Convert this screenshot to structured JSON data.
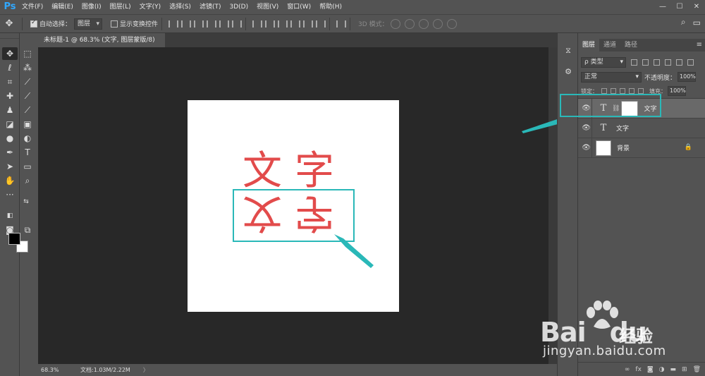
{
  "app": {
    "logo": "Ps"
  },
  "menu": [
    "文件(F)",
    "编辑(E)",
    "图像(I)",
    "图层(L)",
    "文字(Y)",
    "选择(S)",
    "滤镜(T)",
    "3D(D)",
    "视图(V)",
    "窗口(W)",
    "帮助(H)"
  ],
  "window_controls": {
    "minimize": "—",
    "maximize": "☐",
    "close": "✕"
  },
  "options": {
    "auto_select_label": "自动选择：",
    "auto_select_value": "图层",
    "show_transform_label": "显示变换控件",
    "mode_3d_label": "3D 模式："
  },
  "document": {
    "tab_title": "未标题-1 @ 68.3% (文字, 图层蒙版/8) *",
    "close": "×",
    "glyph_top_left": "文",
    "glyph_top_right": "字",
    "glyph_bottom_left": "文",
    "glyph_bottom_right": "字"
  },
  "status": {
    "zoom": "68.3%",
    "doc_info": "文档:1.03M/2.22M",
    "arrow": "〉"
  },
  "layers_panel": {
    "tabs": [
      "图层",
      "通道",
      "路径"
    ],
    "menu_icon": "≡",
    "filter_kind": "ρ 类型",
    "blend_mode": "正常",
    "opacity_label": "不透明度：",
    "opacity_value": "100%",
    "lock_label": "锁定：",
    "fill_label": "填充：",
    "fill_value": "100%",
    "layers": [
      {
        "name": "文字",
        "type_icon": "T",
        "has_mask": true,
        "selected": true
      },
      {
        "name": "文字",
        "type_icon": "T",
        "has_mask": false,
        "selected": false
      },
      {
        "name": "背景",
        "type_icon": "",
        "has_mask": false,
        "selected": false,
        "locked": true
      }
    ],
    "footer_icons": [
      "link-icon",
      "fx-icon",
      "mask-icon",
      "adjustment-icon",
      "group-icon",
      "new-layer-icon",
      "trash-icon"
    ],
    "footer_fx": "fx"
  },
  "watermark": {
    "brand": "Bai",
    "brand2": "du",
    "cn": "经验",
    "url": "jingyan.baidu.com"
  },
  "colors": {
    "annotation": "#2ab8b8",
    "glyph": "#e24b4b",
    "canvas_bg": "#282828",
    "ui_bg": "#535353"
  }
}
